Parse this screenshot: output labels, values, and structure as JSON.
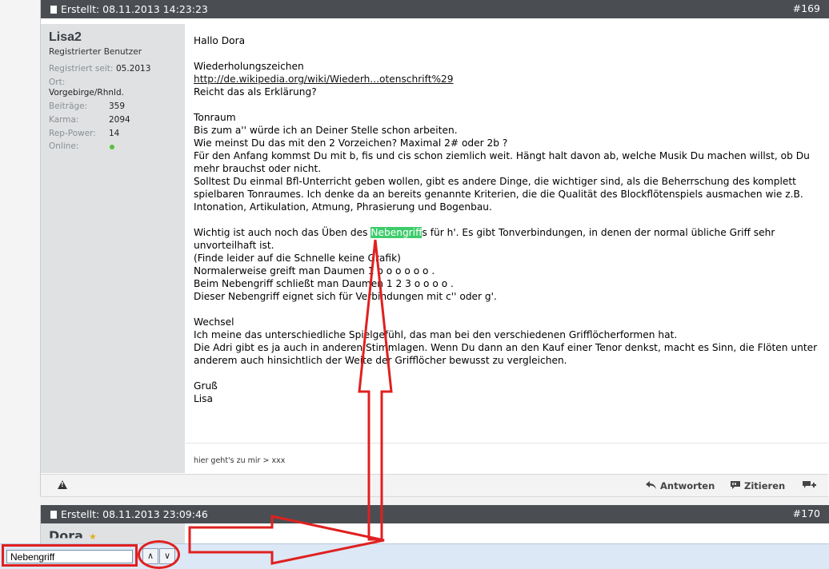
{
  "post1": {
    "created": "Erstellt: 08.11.2013 14:23:23",
    "number": "#169",
    "user": {
      "name": "Lisa2",
      "rank": "Registrierter Benutzer",
      "registered_label": "Registriert seit:",
      "registered_value": "05.2013",
      "location_label": "Ort:",
      "location_value": "Vorgebirge/Rhnld.",
      "posts_label": "Beiträge:",
      "posts_value": "359",
      "karma_label": "Karma:",
      "karma_value": "2094",
      "rep_label": "Rep-Power:",
      "rep_value": "14",
      "online_label": "Online:"
    },
    "body": {
      "greeting": "Hallo Dora",
      "s1_title": "Wiederholungszeichen",
      "s1_link": "http://de.wikipedia.org/wiki/Wiederh...otenschrift%29",
      "s1_q": "Reicht das als Erklärung?",
      "s2_title": "Tonraum",
      "s2_l1": "Bis zum a'' würde ich an Deiner Stelle schon arbeiten.",
      "s2_l2": "Wie meinst Du das mit den 2 Vorzeichen? Maximal 2# oder 2b ?",
      "s2_l3": "Für den Anfang kommst Du mit b, fis und cis schon ziemlich weit. Hängt halt davon ab, welche Musik Du machen willst, ob Du mehr brauchst oder nicht.",
      "s2_l4": "Solltest Du einmal Bfl-Unterricht geben wollen, gibt es andere Dinge, die wichtiger sind, als die Beherrschung des komplett spielbaren Tonraumes. Ich denke da an bereits genannte Kriterien, die die Qualität des Blockflötenspiels ausmachen wie z.B. Intonation, Artikulation, Atmung, Phrasierung und Bogenbau.",
      "s3_pre": "Wichtig ist auch noch das Üben des ",
      "s3_hl": "Nebengriff",
      "s3_post": "s für h'. Es gibt Tonverbindungen, in denen der normal übliche Griff sehr unvorteilhaft ist.",
      "s3_l2": "(Finde leider auf die Schnelle keine Grafik)",
      "s3_l3": "Normalerweise greift man Daumen 1 o o o o o o .",
      "s3_l4": "Beim Nebengriff schließt man Daumen 1 2 3 o o o o .",
      "s3_l5": "Dieser Nebengriff eignet sich für Verbindungen mit c'' oder g'.",
      "s4_title": "Wechsel",
      "s4_l1": "Ich meine das unterschiedliche Spielgefühl, das man bei den verschiedenen Grifflöcherformen hat.",
      "s4_l2": "Die Adri gibt es ja auch in anderen Stimmlagen. Wenn Du dann an den Kauf einer Tenor denkst, macht es Sinn, die Flöten unter anderem auch hinsichtlich der Weite der Grifflöcher bewusst zu vergleichen.",
      "closing": "Gruß",
      "signature_name": "Lisa"
    },
    "signature": "hier geht's zu mir > xxx",
    "actions": {
      "reply": "Antworten",
      "quote": "Zitieren"
    }
  },
  "post2": {
    "created": "Erstellt: 08.11.2013 23:09:46",
    "number": "#170",
    "user_name": "Dora"
  },
  "findbar": {
    "query": "Nebengriff",
    "prev": "∧",
    "next": "∨"
  },
  "colors": {
    "post_header": "#4a4e52",
    "user_column": "#dfe1e3",
    "highlight": "#3dcc6b",
    "annotation_red": "#e02020",
    "findbar": "#dce8f5"
  }
}
